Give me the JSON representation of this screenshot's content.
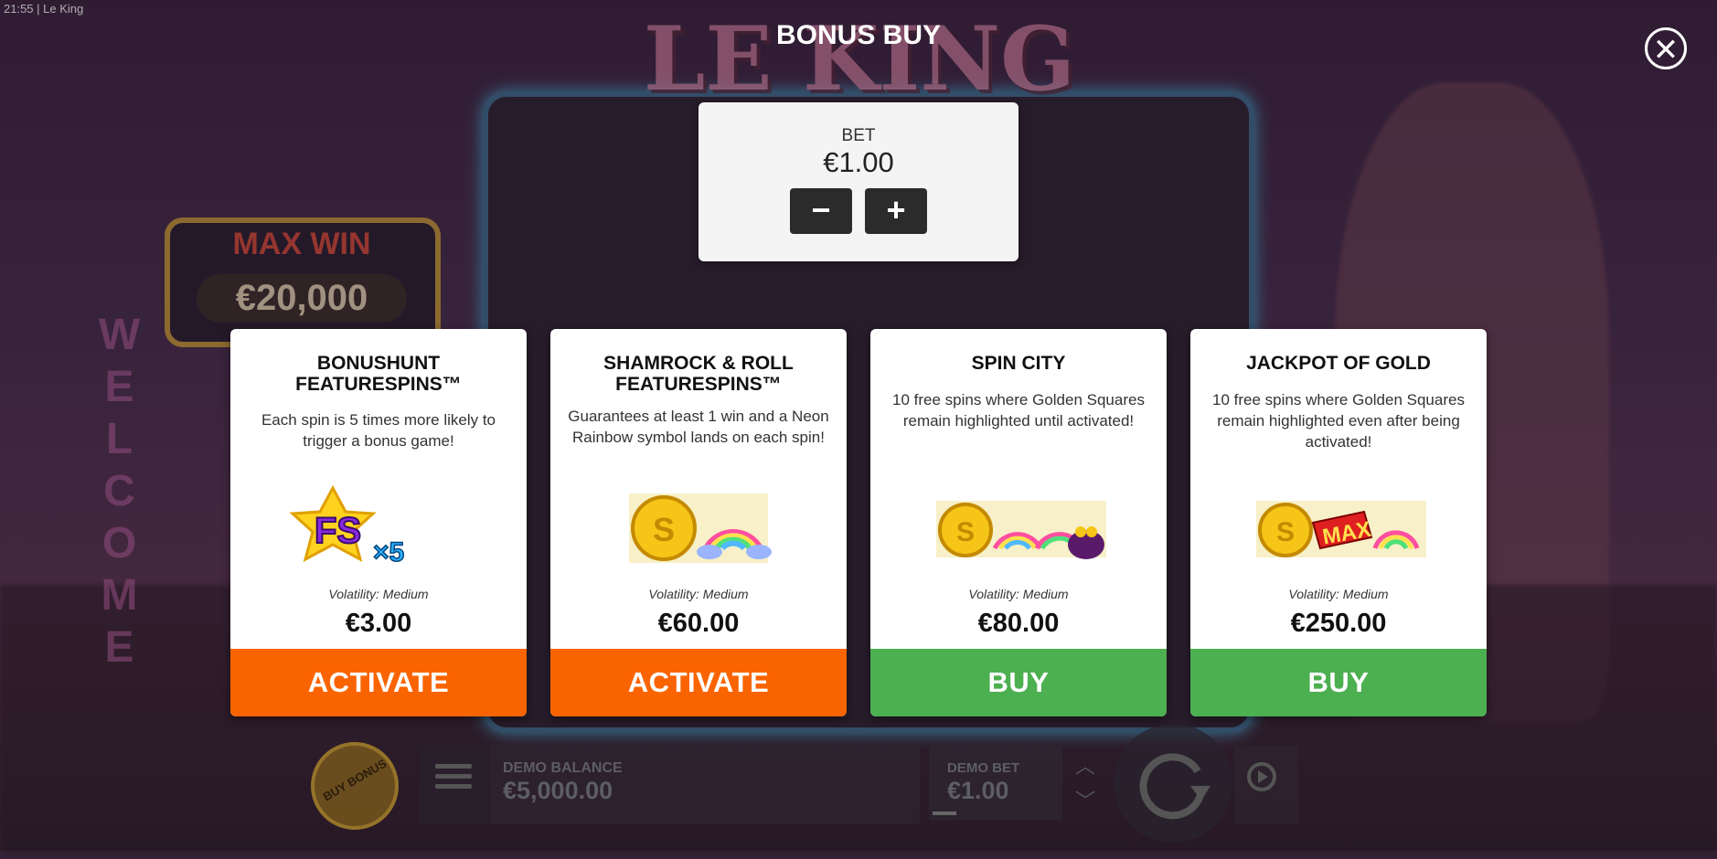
{
  "status_bar": {
    "time": "21:55",
    "app_title": "Le King"
  },
  "background": {
    "logo_text": "LE KING",
    "max_win_title": "MAX WIN",
    "max_win_value": "€20,000",
    "welcome_sign": "WELCOME"
  },
  "modal": {
    "title": "BONUS BUY",
    "close_icon": "close-icon",
    "bet": {
      "label": "BET",
      "value": "€1.00",
      "minus_label": "−",
      "plus_label": "+"
    },
    "cards": [
      {
        "title": "BONUSHUNT FEATURESPINS™",
        "description": "Each spin is 5 times more likely to trigger a bonus game!",
        "art": "fs-x5-icon",
        "art_text": "FS×5",
        "volatility": "Volatility: Medium",
        "price": "€3.00",
        "button": "ACTIVATE",
        "button_color": "#fa6400"
      },
      {
        "title": "SHAMROCK & ROLL FEATURESPINS™",
        "description": "Guarantees at least 1 win and a Neon Rainbow symbol lands on each spin!",
        "art": "coin-rainbow-icon",
        "volatility": "Volatility: Medium",
        "price": "€60.00",
        "button": "ACTIVATE",
        "button_color": "#fa6400"
      },
      {
        "title": "SPIN CITY",
        "description": "10 free spins where Golden Squares remain highlighted until activated!",
        "art": "coin-rainbow-pot-icon",
        "volatility": "Volatility: Medium",
        "price": "€80.00",
        "button": "BUY",
        "button_color": "#4caf50"
      },
      {
        "title": "JACKPOT OF GOLD",
        "description": "10 free spins where Golden Squares remain highlighted even after being activated!",
        "art": "coin-max-rainbow-icon",
        "art_text": "MAX",
        "volatility": "Volatility: Medium",
        "price": "€250.00",
        "button": "BUY",
        "button_color": "#4caf50"
      }
    ]
  },
  "bottom_bar": {
    "buy_bonus_label": "BUY BONUS",
    "demo_balance_label": "DEMO BALANCE",
    "demo_balance_value": "€5,000.00",
    "demo_bet_label": "DEMO BET",
    "demo_bet_value": "€1.00"
  }
}
